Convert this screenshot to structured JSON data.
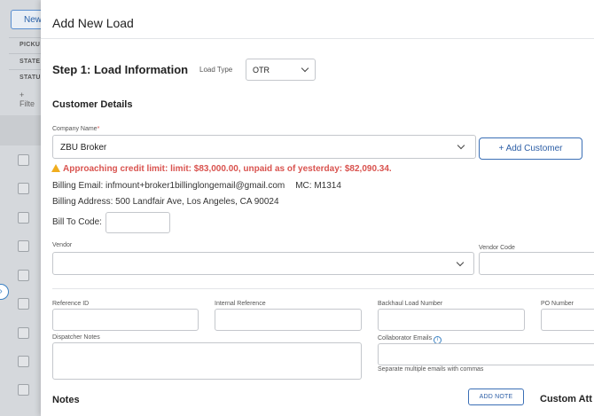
{
  "background": {
    "new_button": "New",
    "labels": [
      "PICKU",
      "STATE",
      "STATU"
    ],
    "filter": "+ Filte",
    "toggle_icon": "chevron-right-icon"
  },
  "modal": {
    "title": "Add New Load",
    "step_title": "Step 1: Load Information",
    "load_type_label": "Load Type",
    "load_type_value": "OTR"
  },
  "customer": {
    "section_title": "Customer Details",
    "company_label": "Company Name",
    "company_required": "*",
    "company_value": "ZBU Broker",
    "add_customer": "+ Add Customer",
    "credit_warning": "Approaching credit limit: limit: $83,000.00, unpaid as of yesterday: $82,090.34.",
    "billing_email": "Billing Email: infmount+broker1billinglongemail@gmail.com",
    "mc": "MC: M1314",
    "billing_address": "Billing Address: 500 Landfair Ave, Los Angeles, CA 90024",
    "bill_to_code_label": "Bill To Code:",
    "bill_to_code_value": ""
  },
  "vendor": {
    "vendor_label": "Vendor",
    "vendor_value": "",
    "vendor_code_label": "Vendor Code",
    "vendor_code_value": ""
  },
  "references": {
    "reference_id_label": "Reference ID",
    "internal_reference_label": "Internal Reference",
    "backhaul_label": "Backhaul Load Number",
    "po_label": "PO Number",
    "dispatcher_notes_label": "Dispatcher Notes",
    "collaborator_label": "Collaborator Emails",
    "collaborator_hint": "Separate multiple emails with commas"
  },
  "notes": {
    "title": "Notes",
    "add_note": "ADD NOTE",
    "custom_title": "Custom Att"
  },
  "colors": {
    "accent": "#2c5ea6",
    "warning": "#d9534f"
  }
}
